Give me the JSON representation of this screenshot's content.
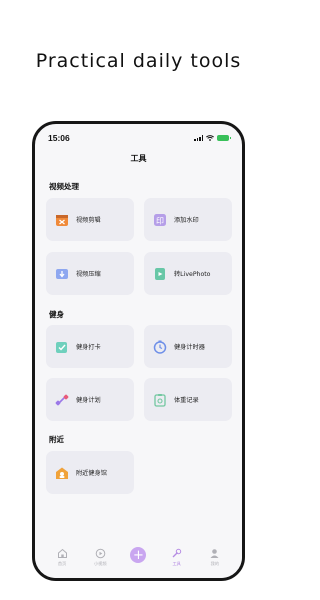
{
  "headline": "Practical daily tools",
  "status_bar": {
    "time": "15:06"
  },
  "nav_title": "工具",
  "sections": {
    "video": {
      "title": "视频处理",
      "items": [
        {
          "label": "视频剪辑",
          "icon": "scissors-icon",
          "color": "#f08a3a"
        },
        {
          "label": "添加水印",
          "icon": "stamp-icon",
          "color": "#b59ee8"
        },
        {
          "label": "视频压缩",
          "icon": "compress-icon",
          "color": "#8ea7f0"
        },
        {
          "label": "转LivePhoto",
          "icon": "livephoto-icon",
          "color": "#68c7a7"
        }
      ]
    },
    "fitness": {
      "title": "健身",
      "items": [
        {
          "label": "健身打卡",
          "icon": "checkin-icon",
          "color": "#6fd0bd"
        },
        {
          "label": "健身计时器",
          "icon": "timer-icon",
          "color": "#6e8fe8"
        },
        {
          "label": "健身计划",
          "icon": "dumbbell-icon",
          "color": "#9b78e8"
        },
        {
          "label": "体重记录",
          "icon": "scale-icon",
          "color": "#72c7a0"
        }
      ]
    },
    "nearby": {
      "title": "附近",
      "items": [
        {
          "label": "附近健身馆",
          "icon": "gym-icon",
          "color": "#f0a23a"
        }
      ]
    }
  },
  "tabbar": {
    "items": [
      {
        "label": "首页",
        "icon": "home-icon"
      },
      {
        "label": "小视频",
        "icon": "video-icon"
      },
      {
        "label": "",
        "icon": "plus-icon"
      },
      {
        "label": "工具",
        "icon": "tools-icon",
        "active": true
      },
      {
        "label": "我的",
        "icon": "profile-icon"
      }
    ]
  }
}
